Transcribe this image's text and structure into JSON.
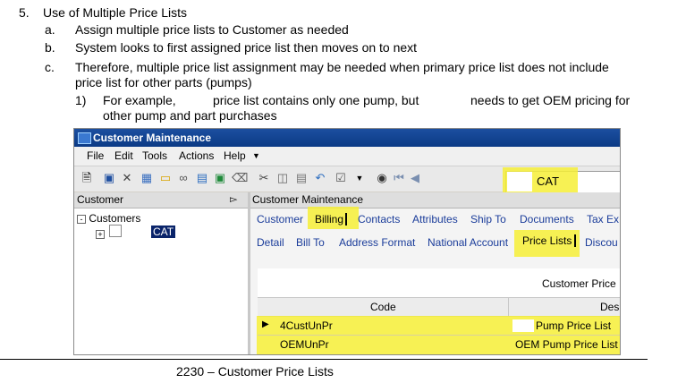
{
  "item": {
    "number": "5.",
    "title": "Use of Multiple Price Lists",
    "subitems": [
      {
        "letter": "a.",
        "text": "Assign multiple price lists to Customer as needed"
      },
      {
        "letter": "b.",
        "text": "System looks to first assigned price list then moves on to next"
      },
      {
        "letter": "c.",
        "text_line1": "Therefore, multiple price list assignment may be needed when primary price list does not include",
        "text_line2": "price list for other parts (pumps)"
      }
    ],
    "example": {
      "number": "1)",
      "line1_a": "For example,",
      "line1_b": "price list contains only one pump, but",
      "line1_c": "needs to get OEM pricing for",
      "line2": "other pump and part purchases"
    }
  },
  "screenshot": {
    "window_title": "Customer Maintenance",
    "menu": [
      "File",
      "Edit",
      "Tools",
      "Actions",
      "Help"
    ],
    "toolbar_field": "CAT",
    "left_panel": {
      "header": "Customer",
      "pin_glyph": "⸸",
      "tree_root": "Customers",
      "tree_child": "CAT"
    },
    "right_panel": {
      "header": "Customer Maintenance",
      "tabs_row1": [
        "Customer",
        "Billing",
        "Contacts",
        "Attributes",
        "Ship To",
        "Documents",
        "Tax Ex"
      ],
      "tabs_row2": [
        "Detail",
        "Bill To",
        "Address Format",
        "National Account",
        "Price Lists",
        "Discou"
      ],
      "grid_title": "Customer Price",
      "columns": [
        "Code",
        "Des"
      ],
      "rows": [
        {
          "code": "4CustUnPr",
          "description": "Pump Price List"
        },
        {
          "code": "OEMUnPr",
          "description": "OEM Pump Price List"
        }
      ]
    },
    "highlight_color": "#f6ee36"
  },
  "footer": "2230 – Customer Price Lists"
}
